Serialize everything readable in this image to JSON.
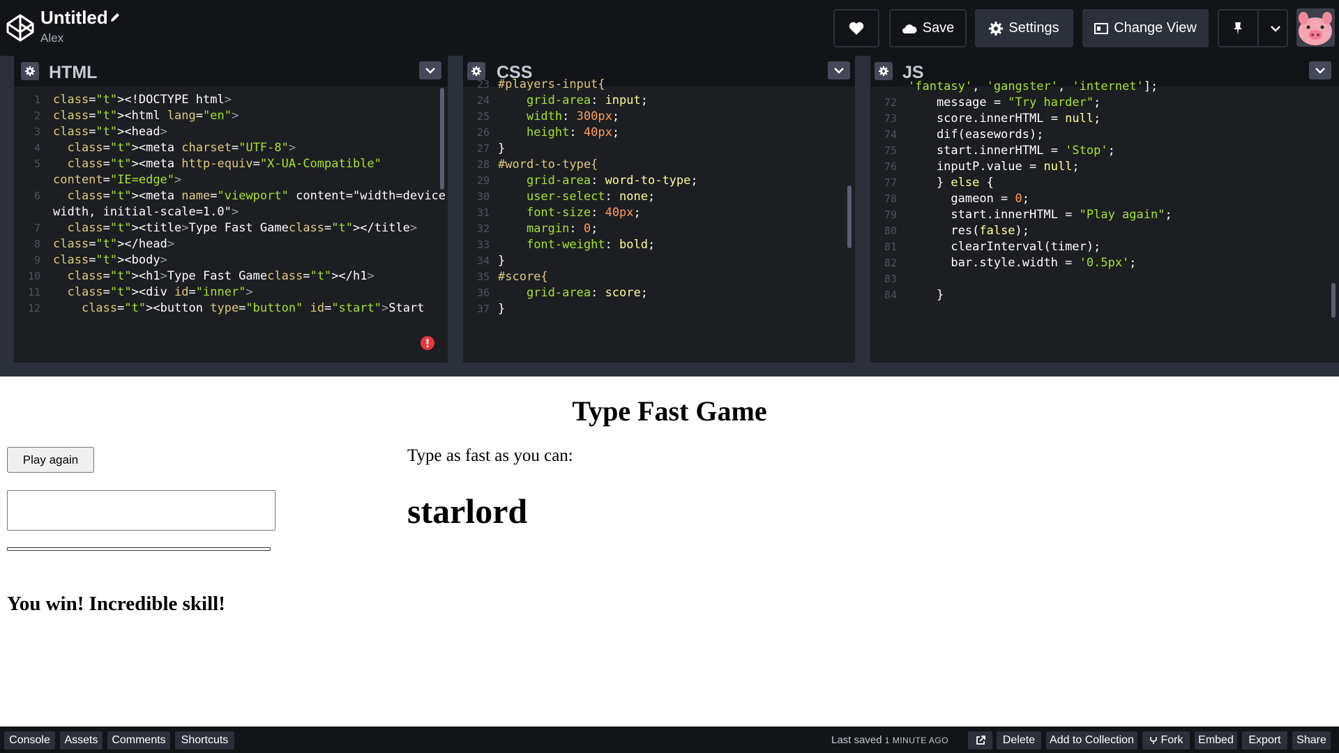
{
  "header": {
    "title": "Untitled",
    "author": "Alex",
    "buttons": {
      "save": "Save",
      "settings": "Settings",
      "change_view": "Change View"
    }
  },
  "editors": {
    "html": {
      "title": "HTML",
      "lines": [
        {
          "n": "1",
          "code": "<!DOCTYPE html>"
        },
        {
          "n": "2",
          "code": "<html lang=\"en\">"
        },
        {
          "n": "3",
          "code": "<head>"
        },
        {
          "n": "4",
          "code": "  <meta charset=\"UTF-8\">"
        },
        {
          "n": "5",
          "code": "  <meta http-equiv=\"X-UA-Compatible\""
        },
        {
          "n": "",
          "code": "content=\"IE=edge\">"
        },
        {
          "n": "6",
          "code": "  <meta name=\"viewport\" content=\"width=device-"
        },
        {
          "n": "",
          "code": "width, initial-scale=1.0\">"
        },
        {
          "n": "7",
          "code": "  <title>Type Fast Game</title>"
        },
        {
          "n": "8",
          "code": "</head>"
        },
        {
          "n": "9",
          "code": "<body>"
        },
        {
          "n": "10",
          "code": "  <h1>Type Fast Game</h1>"
        },
        {
          "n": "11",
          "code": "  <div id=\"inner\">"
        },
        {
          "n": "12",
          "code": "    <button type=\"button\" id=\"start\">Start"
        }
      ]
    },
    "css": {
      "title": "CSS",
      "lines": [
        {
          "n": "23",
          "code": "#players-input{"
        },
        {
          "n": "24",
          "code": "    grid-area: input;"
        },
        {
          "n": "25",
          "code": "    width: 300px;"
        },
        {
          "n": "26",
          "code": "    height: 40px;"
        },
        {
          "n": "27",
          "code": "}"
        },
        {
          "n": "28",
          "code": "#word-to-type{"
        },
        {
          "n": "29",
          "code": "    grid-area: word-to-type;"
        },
        {
          "n": "30",
          "code": "    user-select: none;"
        },
        {
          "n": "31",
          "code": "    font-size: 40px;"
        },
        {
          "n": "32",
          "code": "    margin: 0;"
        },
        {
          "n": "33",
          "code": "    font-weight: bold;"
        },
        {
          "n": "34",
          "code": "}"
        },
        {
          "n": "35",
          "code": "#score{"
        },
        {
          "n": "36",
          "code": "    grid-area: score;"
        },
        {
          "n": "37",
          "code": "}"
        }
      ]
    },
    "js": {
      "title": "JS",
      "lines": [
        {
          "n": "",
          "code": "'fantasy', 'gangster', 'internet'];"
        },
        {
          "n": "72",
          "code": "    message = \"Try harder\";"
        },
        {
          "n": "73",
          "code": "    score.innerHTML = null;"
        },
        {
          "n": "74",
          "code": "    dif(easewords);"
        },
        {
          "n": "75",
          "code": "    start.innerHTML = 'Stop';"
        },
        {
          "n": "76",
          "code": "    inputP.value = null;"
        },
        {
          "n": "77",
          "code": "    } else {"
        },
        {
          "n": "78",
          "code": "      gameon = 0;"
        },
        {
          "n": "79",
          "code": "      start.innerHTML = \"Play again\";"
        },
        {
          "n": "80",
          "code": "      res(false);"
        },
        {
          "n": "81",
          "code": "      clearInterval(timer);"
        },
        {
          "n": "82",
          "code": "      bar.style.width = '0.5px';"
        },
        {
          "n": "83",
          "code": ""
        },
        {
          "n": "84",
          "code": "    }"
        }
      ]
    }
  },
  "preview": {
    "heading": "Type Fast Game",
    "button_label": "Play again",
    "input_value": "",
    "result_message": "You win! Incredible skill!",
    "prompt": "Type as fast as you can:",
    "word": "starlord"
  },
  "footer": {
    "left": [
      "Console",
      "Assets",
      "Comments",
      "Shortcuts"
    ],
    "last_saved_label": "Last saved",
    "last_saved_ago": "1 MINUTE AGO",
    "right": [
      "Delete",
      "Add to Collection",
      "Fork",
      "Embed",
      "Export",
      "Share"
    ]
  },
  "colors": {
    "background": "#1e1f26",
    "header": "#131417",
    "button": "#2c303a",
    "editor": "#1d1e22",
    "error": "#e5383b"
  },
  "icons": [
    "codepen-logo-icon",
    "pencil-icon",
    "heart-icon",
    "cloud-icon",
    "gear-icon",
    "layout-icon",
    "pin-icon",
    "chevron-down-icon",
    "error-icon",
    "external-link-icon",
    "fork-icon",
    "avatar-pig"
  ]
}
